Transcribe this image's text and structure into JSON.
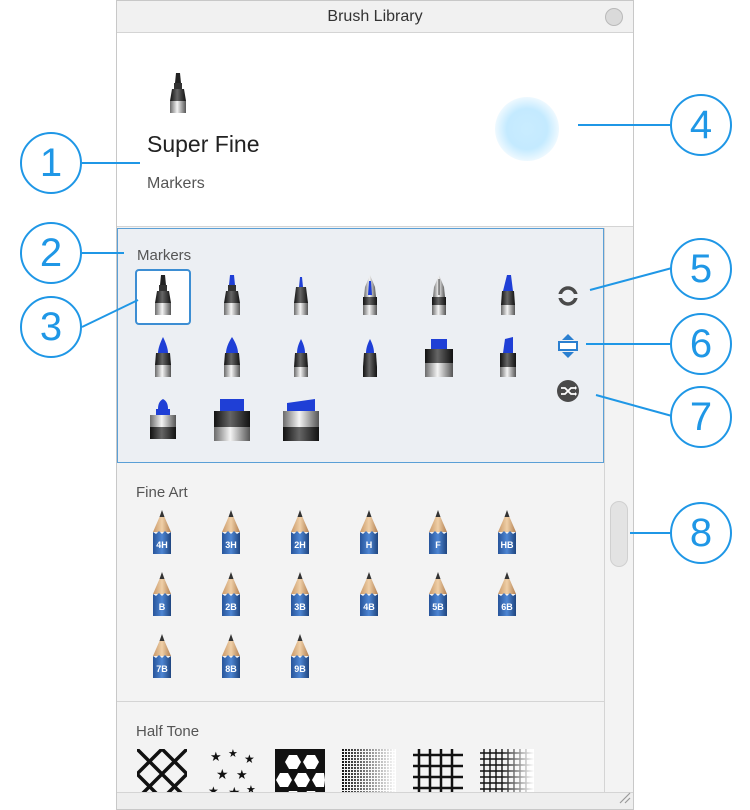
{
  "window": {
    "title": "Brush Library"
  },
  "preview": {
    "brush_name": "Super Fine",
    "brush_category": "Markers"
  },
  "sections": {
    "markers": {
      "title": "Markers"
    },
    "fine_art": {
      "title": "Fine Art",
      "pencils": [
        "4H",
        "3H",
        "2H",
        "H",
        "F",
        "HB",
        "B",
        "2B",
        "3B",
        "4B",
        "5B",
        "6B",
        "7B",
        "8B",
        "9B"
      ]
    },
    "half_tone": {
      "title": "Half Tone"
    }
  },
  "callouts": [
    "1",
    "2",
    "3",
    "4",
    "5",
    "6",
    "7",
    "8"
  ],
  "colors": {
    "accent": "#1f97e6",
    "selection_border": "#3d8ed3",
    "marker_blue": "#1f3fd6"
  }
}
